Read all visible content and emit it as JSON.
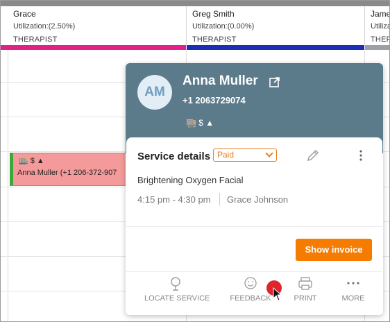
{
  "columns": [
    {
      "name": "Grace",
      "utilization": "Utilization:(2.50%)",
      "role": "THERAPIST",
      "color": "#e0218a"
    },
    {
      "name": "Greg Smith",
      "utilization": "Utilization:(0.00%)",
      "role": "THERAPIST",
      "color": "#1a2fb6"
    },
    {
      "name": "Jame",
      "utilization": "Utilization",
      "role": "THERAP",
      "color": "#9aa0a6"
    }
  ],
  "appointment": {
    "icons": "🏬 $ ▲",
    "text": "Anna Muller (+1 206-372-907"
  },
  "popover": {
    "initials": "AM",
    "client_name": "Anna Muller",
    "phone": "+1 2063729074",
    "icons": "🏬 $ ▲",
    "service_details_label": "Service details",
    "payment_status": "Paid",
    "service_name": "Brightening Oxygen Facial",
    "time_range": "4:15 pm - 4:30 pm",
    "staff": "Grace Johnson",
    "show_invoice_label": "Show invoice",
    "actions": {
      "locate": "LOCATE SERVICE",
      "feedback": "FEEDBACK",
      "print": "PRINT",
      "more": "MORE"
    }
  },
  "colors": {
    "header_bg": "#5b7b8b",
    "accent_orange": "#f57c00",
    "appointment_bg": "#f59a9a",
    "appointment_stripe": "#3aa83a"
  }
}
